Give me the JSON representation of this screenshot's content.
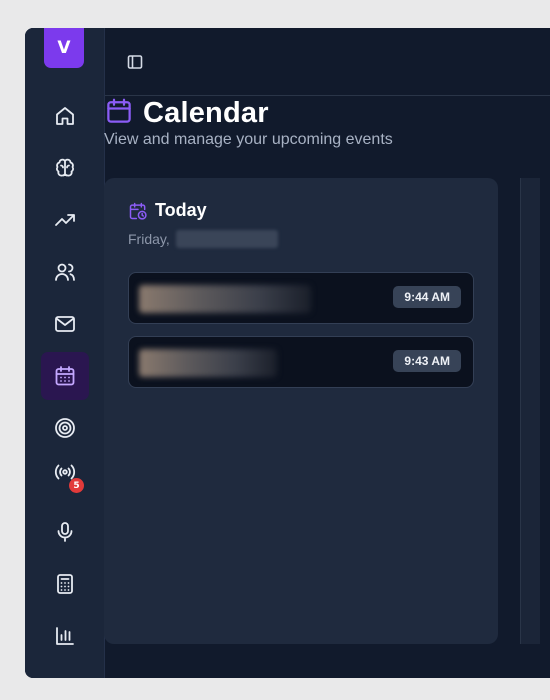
{
  "app": {
    "logo_letter": "V"
  },
  "sidebar": {
    "items": [
      {
        "name": "home",
        "icon": "home-icon",
        "active": false
      },
      {
        "name": "brain",
        "icon": "brain-icon",
        "active": false
      },
      {
        "name": "trending",
        "icon": "trending-up-icon",
        "active": false
      },
      {
        "name": "users",
        "icon": "users-icon",
        "active": false
      },
      {
        "name": "mail",
        "icon": "mail-icon",
        "active": false
      },
      {
        "name": "calendar",
        "icon": "calendar-icon",
        "active": true
      },
      {
        "name": "target",
        "icon": "target-icon",
        "active": false
      },
      {
        "name": "broadcast",
        "icon": "radio-icon",
        "active": false,
        "badge": "5"
      },
      {
        "name": "microphone",
        "icon": "mic-icon",
        "active": false
      },
      {
        "name": "calculator",
        "icon": "calculator-icon",
        "active": false
      },
      {
        "name": "analytics",
        "icon": "bar-chart-icon",
        "active": false
      }
    ]
  },
  "header": {
    "title": "Calendar",
    "subtitle": "View and manage your upcoming events"
  },
  "today": {
    "label": "Today",
    "date_prefix": "Friday,",
    "events": [
      {
        "time": "9:44 AM"
      },
      {
        "time": "9:43 AM"
      }
    ]
  },
  "colors": {
    "accent": "#8b5cf6",
    "brand": "#7c3aed",
    "badge": "#e23a3a"
  }
}
